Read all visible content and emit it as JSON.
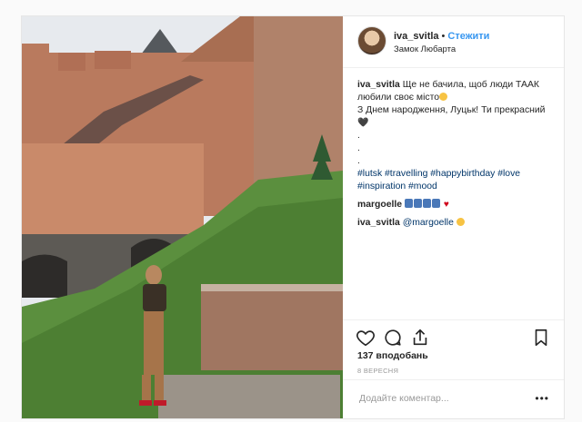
{
  "post": {
    "username": "iva_svitla",
    "separator": "•",
    "follow_label": "Стежити",
    "location": "Замок Любарта"
  },
  "caption": {
    "username": "iva_svitla",
    "line1": "Ще не бачила, щоб люди ТААК любили своє місто",
    "line2": "З Днем народження, Луцьк! Ти прекрасний",
    "dots": [
      ".",
      ".",
      "."
    ],
    "hashtags": "#lutsk #travelling #happybirthday #love #inspiration #mood",
    "emoji1": "smiling-face-emoji",
    "emoji2": "black-heart-emoji"
  },
  "comments": [
    {
      "username": "margoelle",
      "text": "",
      "emojis": [
        "blue-emoji",
        "blue-emoji",
        "blue-emoji",
        "blue-emoji"
      ],
      "trailing": "red-heart"
    },
    {
      "username": "iva_svitla",
      "mention": "@margoelle",
      "emoji": "face-emoji"
    }
  ],
  "likes_label": "137 вподобань",
  "date_label": "8 ВЕРЕСНЯ",
  "add_comment": {
    "placeholder": "Додайте коментар..."
  },
  "more_label": "•••",
  "heart_black": "🖤",
  "heart_red": "♥",
  "colors": {
    "follow": "#3897f0",
    "hashtag": "#003569",
    "border": "#efefef",
    "muted": "#999999"
  },
  "icons": [
    "heart-icon",
    "comment-icon",
    "share-icon",
    "bookmark-icon",
    "more-options-icon"
  ]
}
